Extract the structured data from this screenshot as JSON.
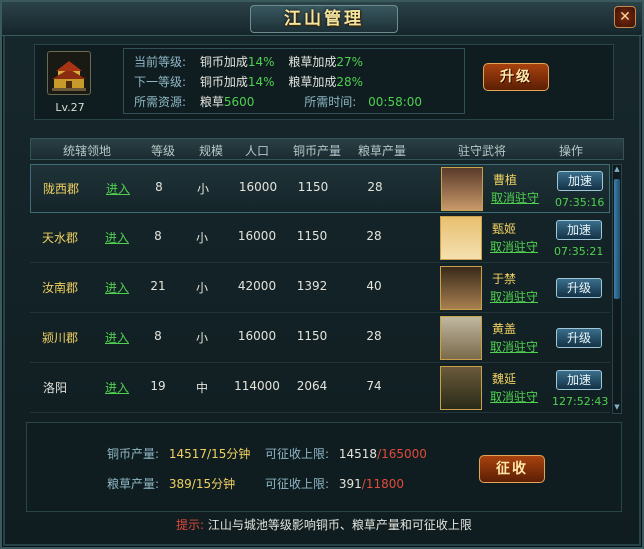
{
  "window": {
    "title": "江山管理",
    "close": "✕"
  },
  "info": {
    "level_label": "Lv.27",
    "current_level_label": "当前等级:",
    "next_level_label": "下一等级:",
    "required_label": "所需资源:",
    "copper_bonus_label": "铜币加成",
    "grain_bonus_label": "粮草加成",
    "current_copper_bonus": "14%",
    "current_grain_bonus": "27%",
    "next_copper_bonus": "14%",
    "next_grain_bonus": "28%",
    "grain_label": "粮草",
    "grain_required": "5600",
    "time_label": "所需时间:",
    "time_required": "00:58:00",
    "upgrade_button": "升级"
  },
  "table": {
    "headers": [
      "统辖领地",
      "等级",
      "规模",
      "人口",
      "铜币产量",
      "粮草产量",
      "驻守武将",
      "操作"
    ],
    "enter_label": "进入",
    "cancel_label": "取消驻守",
    "rows": [
      {
        "region": "陇西郡",
        "level": "8",
        "scale": "小",
        "population": "16000",
        "copper": "1150",
        "grain": "28",
        "general": "曹植",
        "has_cancel": true,
        "action": "加速",
        "timer": "07:35:16"
      },
      {
        "region": "天水郡",
        "level": "8",
        "scale": "小",
        "population": "16000",
        "copper": "1150",
        "grain": "28",
        "general": "甄姬",
        "has_cancel": true,
        "action": "加速",
        "timer": "07:35:21"
      },
      {
        "region": "汝南郡",
        "level": "21",
        "scale": "小",
        "population": "42000",
        "copper": "1392",
        "grain": "40",
        "general": "于禁",
        "has_cancel": true,
        "action": "升级",
        "timer": ""
      },
      {
        "region": "颍川郡",
        "level": "8",
        "scale": "小",
        "population": "16000",
        "copper": "1150",
        "grain": "28",
        "general": "黄盖",
        "has_cancel": true,
        "action": "升级",
        "timer": ""
      },
      {
        "region": "洛阳",
        "level": "19",
        "scale": "中",
        "population": "114000",
        "copper": "2064",
        "grain": "74",
        "general": "魏延",
        "has_cancel": true,
        "action": "加速",
        "timer": "127:52:43"
      }
    ]
  },
  "summary": {
    "copper_output_label": "铜币产量:",
    "copper_output": "14517/15分钟",
    "copper_cap_label": "可征收上限:",
    "copper_cap_current": "14518",
    "copper_cap_max": "/165000",
    "grain_output_label": "粮草产量:",
    "grain_output": "389/15分钟",
    "grain_cap_label": "可征收上限:",
    "grain_cap_current": "391",
    "grain_cap_max": "/11800",
    "collect_button": "征收"
  },
  "tip": {
    "label": "提示:",
    "text": "江山与城池等级影响铜币、粮草产量和可征收上限"
  },
  "colors": {
    "accent_green": "#4fd04f",
    "gold": "#f0d060",
    "red": "#e04a3a",
    "panel": "#0f1d21"
  }
}
